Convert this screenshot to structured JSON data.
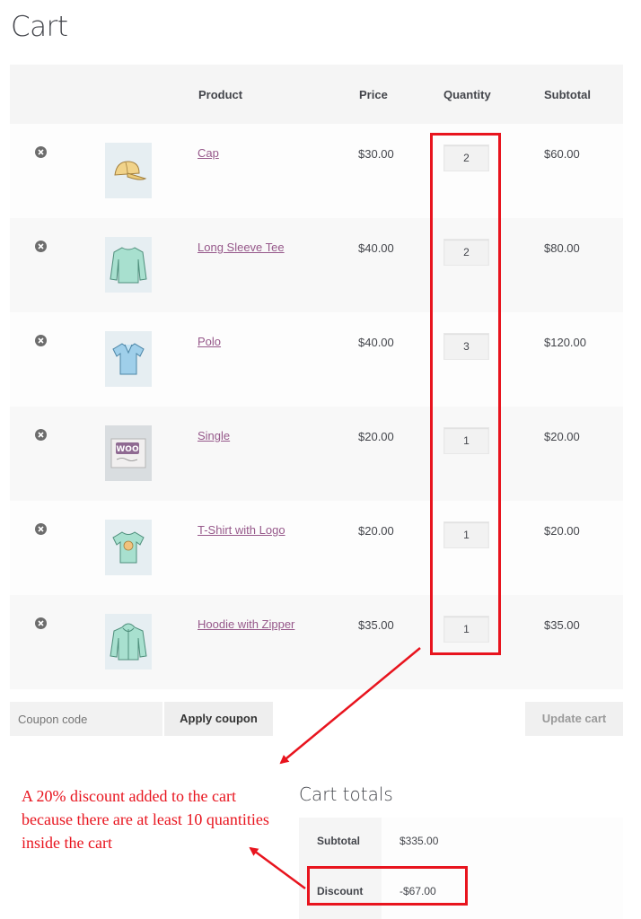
{
  "page": {
    "title": "Cart"
  },
  "table": {
    "headers": {
      "product": "Product",
      "price": "Price",
      "quantity": "Quantity",
      "subtotal": "Subtotal"
    },
    "rows": [
      {
        "name": "Cap",
        "price": "$30.00",
        "quantity": "2",
        "subtotal": "$60.00",
        "thumb_icon": "cap-icon"
      },
      {
        "name": "Long Sleeve Tee",
        "price": "$40.00",
        "quantity": "2",
        "subtotal": "$80.00",
        "thumb_icon": "long-sleeve-icon"
      },
      {
        "name": "Polo",
        "price": "$40.00",
        "quantity": "3",
        "subtotal": "$120.00",
        "thumb_icon": "polo-icon"
      },
      {
        "name": "Single",
        "price": "$20.00",
        "quantity": "1",
        "subtotal": "$20.00",
        "thumb_icon": "woo-single-icon"
      },
      {
        "name": "T-Shirt with Logo",
        "price": "$20.00",
        "quantity": "1",
        "subtotal": "$20.00",
        "thumb_icon": "tshirt-icon"
      },
      {
        "name": "Hoodie with Zipper",
        "price": "$35.00",
        "quantity": "1",
        "subtotal": "$35.00",
        "thumb_icon": "hoodie-icon"
      }
    ]
  },
  "actions": {
    "coupon_placeholder": "Coupon code",
    "apply_label": "Apply coupon",
    "update_label": "Update cart"
  },
  "totals": {
    "title": "Cart totals",
    "subtotal_label": "Subtotal",
    "subtotal_value": "$335.00",
    "discount_label": "Discount",
    "discount_value": "-$67.00"
  },
  "annotation": {
    "text": "A 20% discount added to the cart because there are at least 10 quantities inside the cart",
    "color": "#e8141e"
  },
  "colors": {
    "link": "#96588a",
    "annotation": "#e8141e"
  }
}
